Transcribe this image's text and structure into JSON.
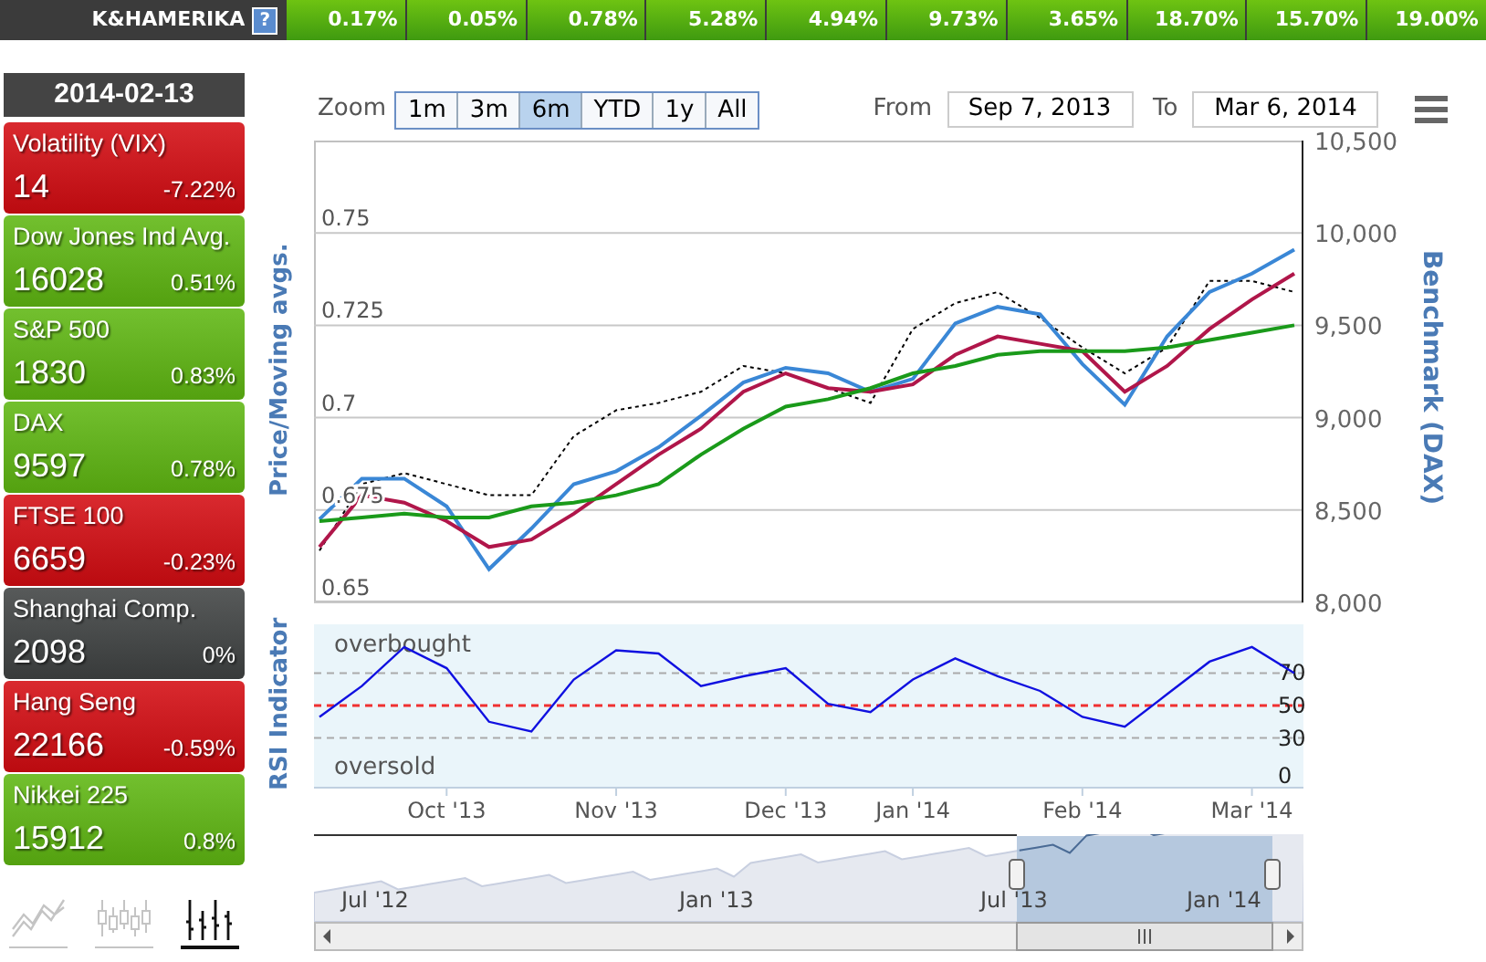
{
  "ticker_bar": {
    "label": "K&HAMERIKA",
    "help": "?",
    "values": [
      "0.17%",
      "0.05%",
      "0.78%",
      "5.28%",
      "4.94%",
      "9.73%",
      "3.65%",
      "18.70%",
      "15.70%",
      "19.00%"
    ]
  },
  "date": "2014-02-13",
  "indices": [
    {
      "name": "Volatility (VIX)",
      "value": "14",
      "change": "-7.22%",
      "color": "#d40c12"
    },
    {
      "name": "Dow Jones Ind Avg.",
      "value": "16028",
      "change": "0.51%",
      "color": "#5fb712"
    },
    {
      "name": "S&P 500",
      "value": "1830",
      "change": "0.83%",
      "color": "#5fb712"
    },
    {
      "name": "DAX",
      "value": "9597",
      "change": "0.78%",
      "color": "#5fb712"
    },
    {
      "name": "FTSE 100",
      "value": "6659",
      "change": "-0.23%",
      "color": "#d40c12"
    },
    {
      "name": "Shanghai Comp.",
      "value": "2098",
      "change": "0%",
      "color": "#404343"
    },
    {
      "name": "Hang Seng",
      "value": "22166",
      "change": "-0.59%",
      "color": "#d40c12"
    },
    {
      "name": "Nikkei 225",
      "value": "15912",
      "change": "0.8%",
      "color": "#5fb712"
    }
  ],
  "chart_type_buttons": [
    {
      "kind": "line",
      "selected": false
    },
    {
      "kind": "candlestick",
      "selected": false
    },
    {
      "kind": "ohlc",
      "selected": true
    }
  ],
  "zoom": {
    "label": "Zoom",
    "buttons": [
      {
        "label": "1m",
        "selected": false
      },
      {
        "label": "3m",
        "selected": false
      },
      {
        "label": "6m",
        "selected": true
      },
      {
        "label": "YTD",
        "selected": false
      },
      {
        "label": "1y",
        "selected": false
      },
      {
        "label": "All",
        "selected": false
      }
    ]
  },
  "range": {
    "from_label": "From",
    "from": "Sep 7, 2013",
    "to_label": "To",
    "to": "Mar 6, 2014"
  },
  "price_chart": {
    "chart_data": {
      "type": "line",
      "grid": true,
      "ylabel": "Price/Moving avgs.",
      "y2label": "Benchmark (DAX)",
      "ylim": [
        0.65,
        0.775
      ],
      "yticks": [
        0.65,
        0.675,
        0.7,
        0.725,
        0.75
      ],
      "y2lim": [
        8000,
        10500
      ],
      "y2ticks": [
        {
          "value": 8000,
          "label": "8,000"
        },
        {
          "value": 8500,
          "label": "8,500"
        },
        {
          "value": 9000,
          "label": "9,000"
        },
        {
          "value": 9500,
          "label": "9,500"
        },
        {
          "value": 10000,
          "label": "10,000"
        },
        {
          "value": 10500,
          "label": "10,500"
        }
      ],
      "series": [
        {
          "color": "#000000",
          "line_style": "dotted",
          "values": [
            0.664,
            0.682,
            0.685,
            0.682,
            0.679,
            0.679,
            0.695,
            0.702,
            0.704,
            0.707,
            0.714,
            0.712,
            0.708,
            0.704,
            0.724,
            0.731,
            0.734,
            0.727,
            0.719,
            0.712,
            0.719,
            0.737,
            0.737,
            0.734
          ]
        },
        {
          "axis": "y2",
          "color": "#3a87d6",
          "values": [
            8450,
            8670,
            8670,
            8520,
            8180,
            8400,
            8640,
            8710,
            8840,
            9010,
            9190,
            9270,
            9240,
            9140,
            9210,
            9510,
            9600,
            9560,
            9290,
            9070,
            9440,
            9680,
            9780,
            9910
          ]
        },
        {
          "color": "#b0164a",
          "values": [
            0.665,
            0.679,
            0.677,
            0.672,
            0.665,
            0.667,
            0.674,
            0.682,
            0.69,
            0.697,
            0.707,
            0.712,
            0.708,
            0.707,
            0.709,
            0.717,
            0.722,
            0.72,
            0.718,
            0.707,
            0.714,
            0.724,
            0.732,
            0.739
          ]
        },
        {
          "color": "#1a9a1a",
          "values": [
            0.672,
            0.673,
            0.674,
            0.673,
            0.673,
            0.676,
            0.677,
            0.679,
            0.682,
            0.69,
            0.697,
            0.703,
            0.705,
            0.708,
            0.712,
            0.714,
            0.717,
            0.718,
            0.718,
            0.718,
            0.719,
            0.721,
            0.723,
            0.725
          ]
        }
      ]
    }
  },
  "rsi_chart": {
    "overbought": "overbought",
    "oversold": "oversold",
    "chart_data": {
      "type": "line",
      "ylabel": "RSI Indicator",
      "categories": [
        null,
        null,
        null,
        "Oct '13",
        null,
        null,
        null,
        "Nov '13",
        null,
        null,
        null,
        "Dec '13",
        null,
        null,
        "Jan '14",
        null,
        null,
        null,
        "Feb '14",
        null,
        null,
        null,
        "Mar '14",
        null
      ],
      "ylim": [
        0,
        100
      ],
      "yticks": [
        {
          "value": 0,
          "label": "0"
        },
        {
          "value": 30,
          "label": "30"
        },
        {
          "value": 50,
          "label": "50"
        },
        {
          "value": 70,
          "label": "70"
        }
      ],
      "grid": true,
      "ref_lines": [
        {
          "axis": "y",
          "value": 50,
          "color": "#f03030",
          "line_style": "dashed"
        }
      ],
      "series": [
        {
          "color": "#1010e0",
          "values": [
            43,
            62,
            86,
            73,
            40,
            34,
            66,
            84,
            82,
            62,
            68,
            73,
            51,
            46,
            66,
            79,
            68,
            59,
            43,
            37,
            57,
            77,
            86,
            70
          ]
        }
      ]
    }
  },
  "navigator": {
    "labels": [
      "Jul '12",
      "Jan '13",
      "Jul '13",
      "Jan '14"
    ]
  }
}
